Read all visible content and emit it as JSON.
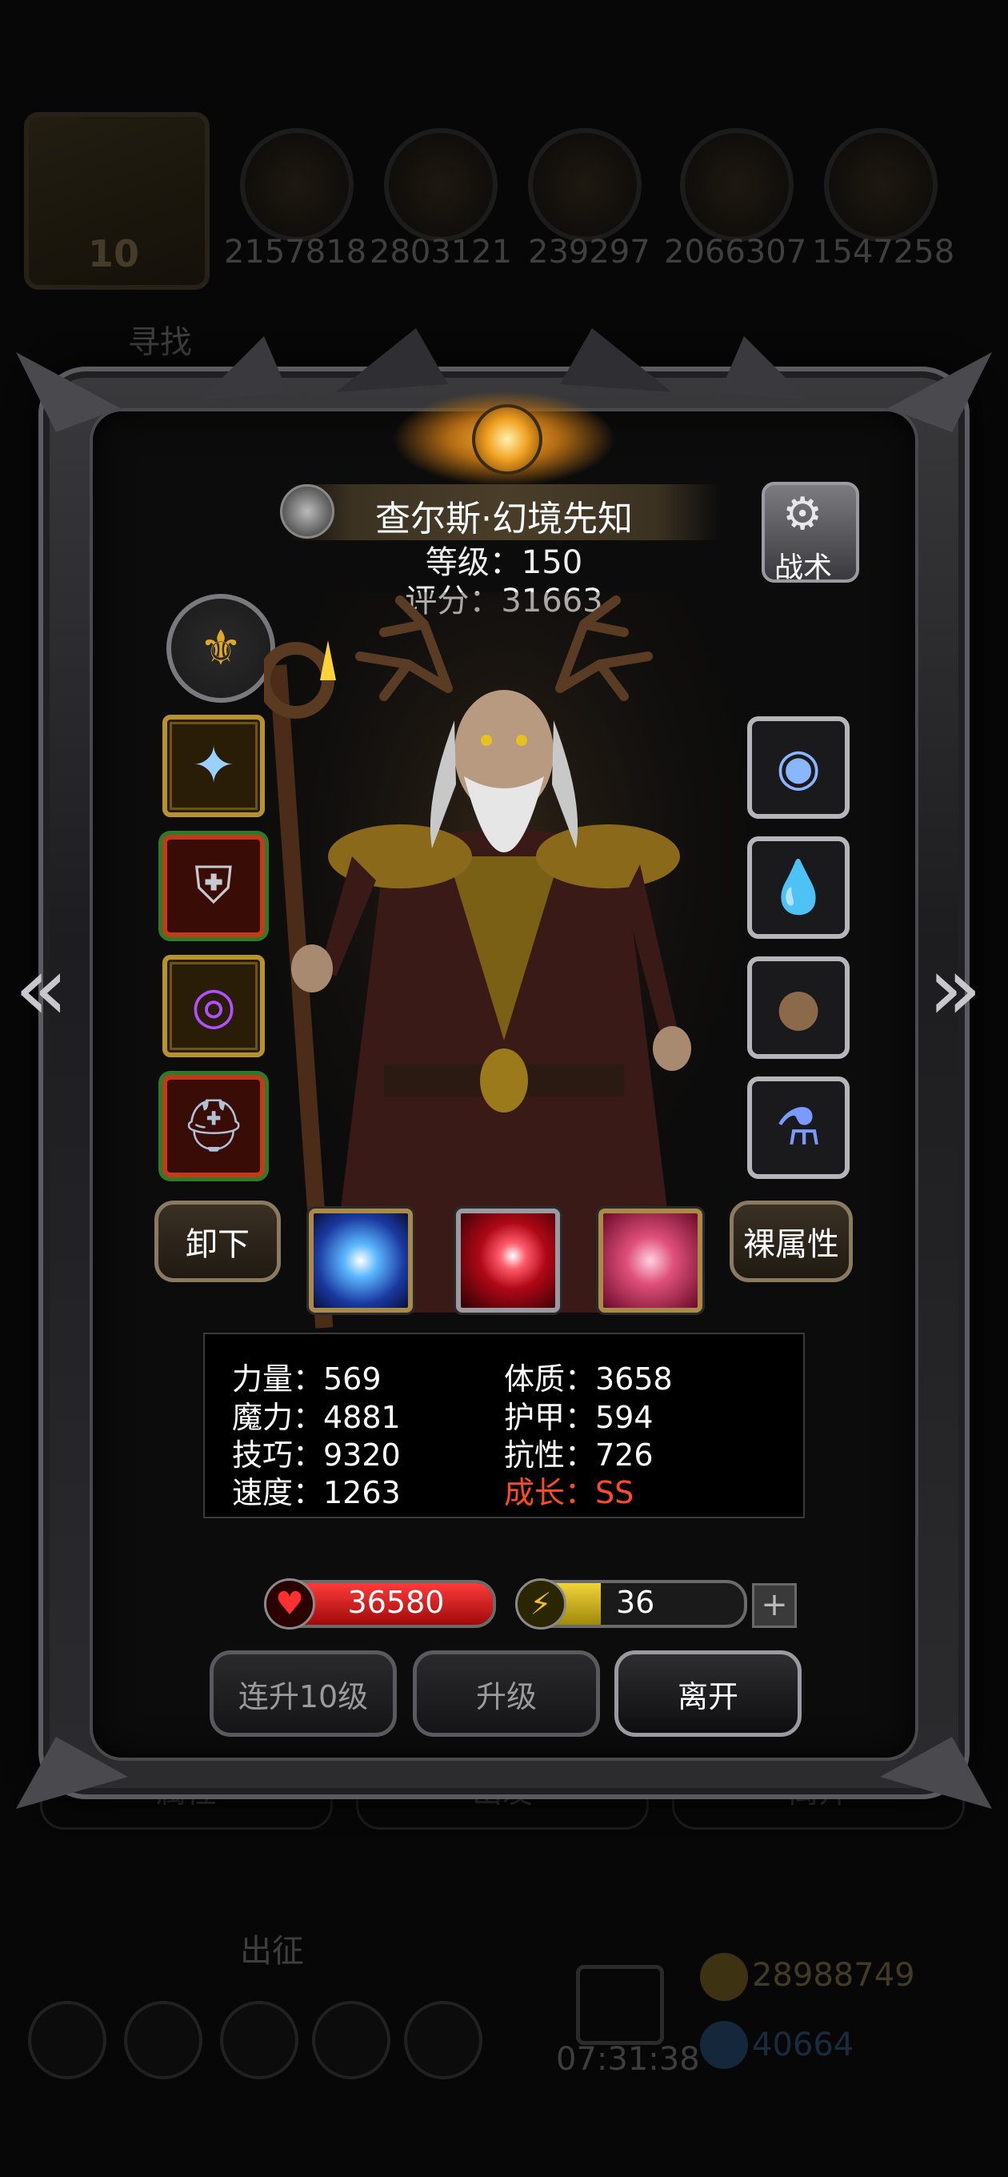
{
  "background": {
    "avatar_level": "10",
    "resources": [
      "2157818",
      "2803121",
      "239297",
      "2066307",
      "1547258"
    ],
    "quest_text": "寻找",
    "tabs": [
      "属性",
      "出发",
      "离开"
    ],
    "deploy_label": "出征",
    "timer": "07:31:38",
    "gold": "28988749",
    "gems": "40664"
  },
  "hero": {
    "name": "查尔斯·幻境先知",
    "level_text": "等级：150",
    "score_text": "评分：31663",
    "tactics_label": "战术"
  },
  "equipment_left": [
    {
      "icon": "staff-icon",
      "frame": "gold"
    },
    {
      "icon": "armor-icon",
      "frame": "red"
    },
    {
      "icon": "ring-icon",
      "frame": "gold"
    },
    {
      "icon": "helmet-icon",
      "frame": "red"
    }
  ],
  "equipment_right": [
    {
      "icon": "eye-amulet-icon"
    },
    {
      "icon": "water-drop-icon"
    },
    {
      "icon": "shell-icon"
    },
    {
      "icon": "potion-icon"
    }
  ],
  "buttons": {
    "unequip": "卸下",
    "base_attributes": "裸属性",
    "level_up_10": "连升10级",
    "level_up": "升级",
    "leave": "离开"
  },
  "skills": [
    "light-burst-icon",
    "fire-slash-icon",
    "web-curse-icon"
  ],
  "stats": {
    "strength": "力量：569",
    "magic": "魔力：4881",
    "skill": "技巧：9320",
    "speed": "速度：1263",
    "constitution": "体质：3658",
    "armor": "护甲：594",
    "resistance": "抗性：726",
    "growth": "成长：SS"
  },
  "bars": {
    "hp_value": "36580",
    "hp_fill_percent": 100,
    "energy_value": "36",
    "energy_fill_percent": 36
  },
  "colors": {
    "growth": "#ff4a2a",
    "hp": "#e01a1a",
    "energy": "#e0c22a",
    "gold_frame": "#b8922a"
  }
}
